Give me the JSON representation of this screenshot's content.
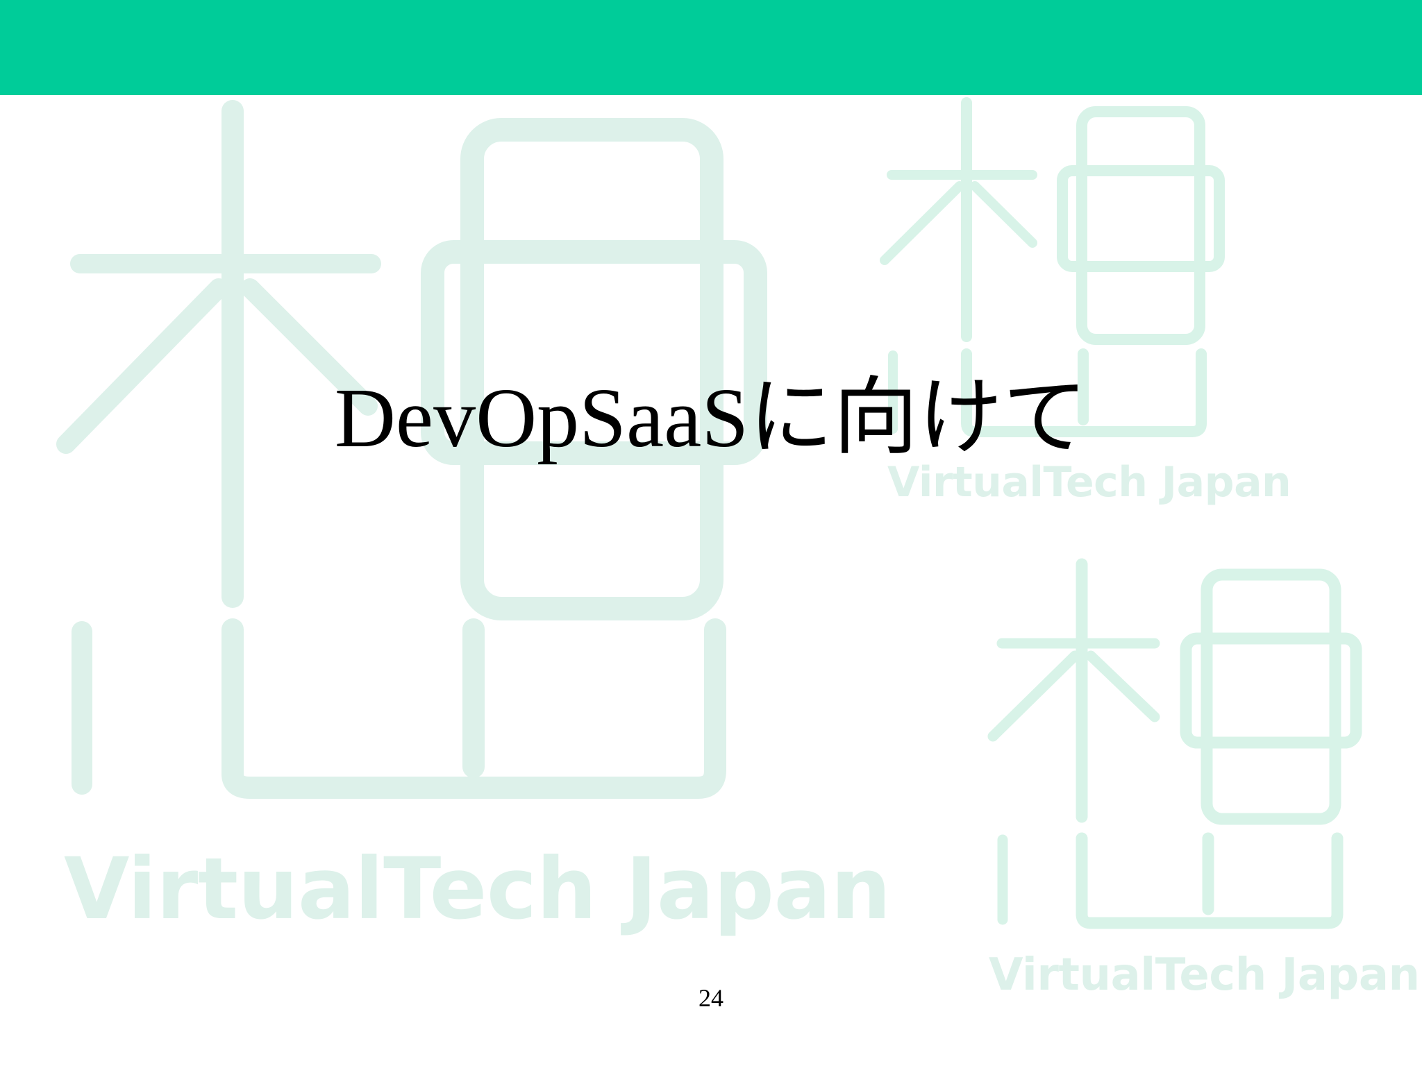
{
  "slide": {
    "title": "DevOpSaaSに向けて",
    "page_number": "24"
  },
  "watermark": {
    "text": "VirtualTech Japan"
  },
  "colors": {
    "header_bar": "#00CC99",
    "watermark": "#DDF1EA",
    "watermark_small": "#D8F3E8",
    "text": "#000000",
    "background": "#FFFFFF"
  },
  "icons": {
    "watermark_logo": "virtualtech-japan-logo-icon"
  }
}
